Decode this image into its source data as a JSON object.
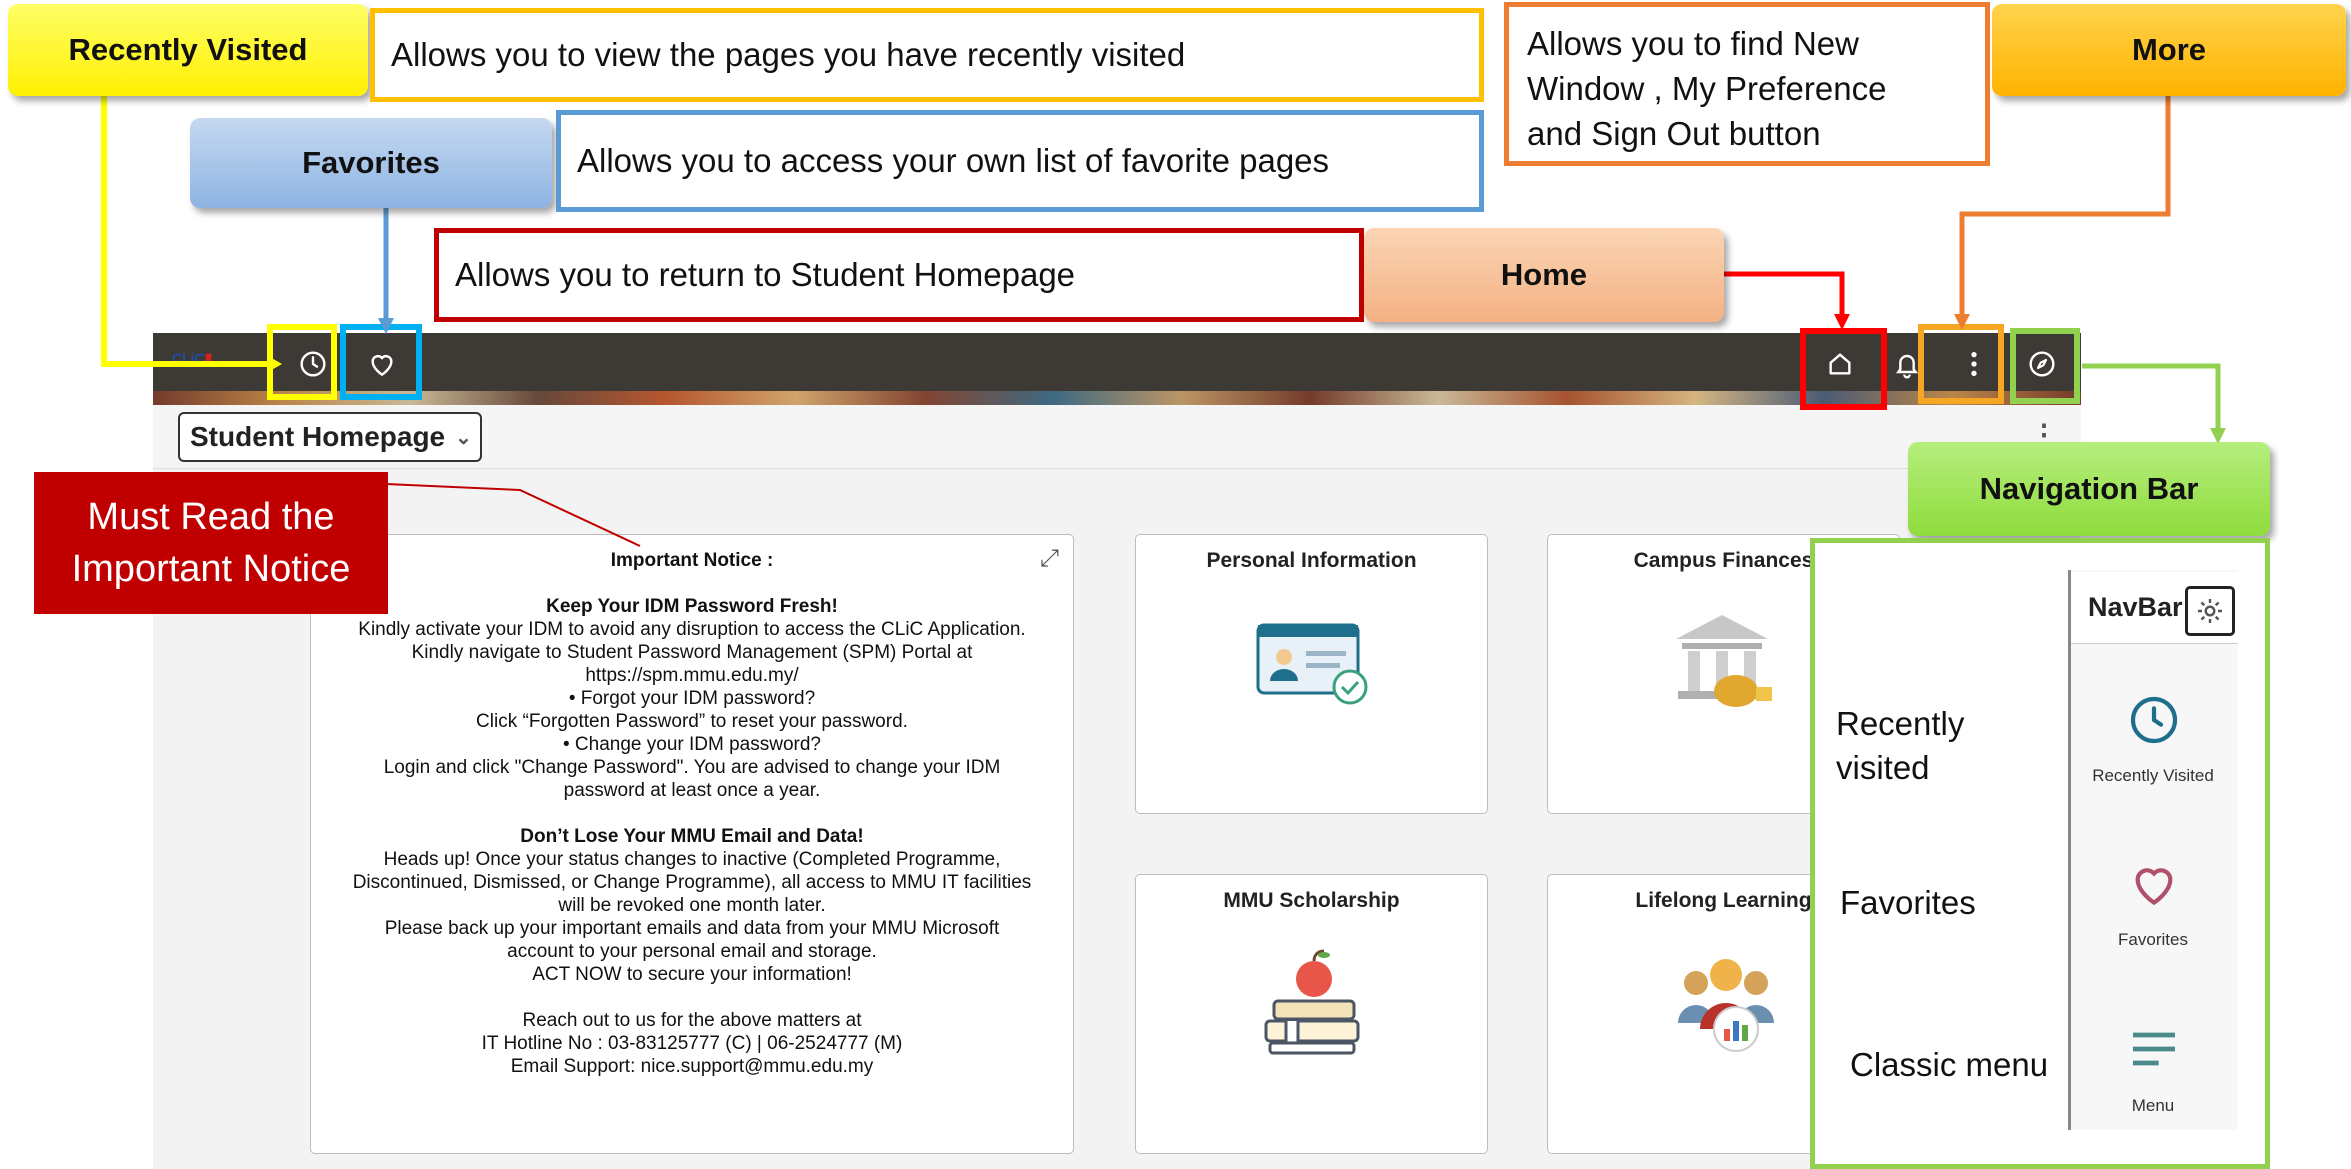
{
  "app": {
    "logo_prefix": "CLiC",
    "logo_suffix": "▮",
    "homepage_label": "Student Homepage",
    "subheader_menu": "⋮"
  },
  "tiles": {
    "notice": {
      "title": "Important Notice :",
      "h1": "Keep Your IDM Password Fresh!",
      "lines1": [
        "Kindly activate your IDM to avoid any disruption to access the CLiC Application.",
        "Kindly navigate to Student Password Management (SPM) Portal at",
        "https://spm.mmu.edu.my/",
        "• Forgot your IDM password?",
        "Click “Forgotten Password” to reset your password.",
        "• Change your IDM password?",
        "Login and click \"Change Password\". You are advised to change your IDM",
        "password at least once a year."
      ],
      "h2": "Don’t Lose Your MMU Email and Data!",
      "lines2": [
        "Heads up! Once your status changes to inactive (Completed Programme,",
        "Discontinued, Dismissed, or Change Programme), all access to MMU IT facilities",
        "will be revoked one month later.",
        "Please back up your important emails and data from your MMU Microsoft",
        "account to your personal email and storage.",
        "ACT NOW to secure your information!"
      ],
      "lines3": [
        "Reach out to us for the above matters at",
        "IT Hotline No : 03-83125777 (C) | 06-2524777 (M)",
        "Email Support: nice.support@mmu.edu.my"
      ]
    },
    "personal_information": "Personal Information",
    "campus_finances": "Campus Finances",
    "mmu_scholarship": "MMU Scholarship",
    "lifelong_learning": "Lifelong Learning"
  },
  "annotations": {
    "recently_visited_tag": "Recently Visited",
    "recently_visited_desc": "Allows you to view the pages you have recently visited",
    "favorites_tag": "Favorites",
    "favorites_desc": "Allows you to access your own list of favorite pages",
    "home_tag": "Home",
    "home_desc": "Allows you to return to Student Homepage",
    "more_tag": "More",
    "more_desc_1": "Allows you to find New",
    "more_desc_2": "Window , My Preference",
    "more_desc_3": "and Sign Out button",
    "notice_tag_1": "Must Read the",
    "notice_tag_2": "Important Notice",
    "navbar_tag": "Navigation Bar"
  },
  "navbar_panel": {
    "title": "NavBar",
    "recently_visited": "Recently Visited",
    "favorites": "Favorites",
    "menu": "Menu",
    "side_recently_1": "Recently",
    "side_recently_2": "visited",
    "side_favorites": "Favorites",
    "side_classic": "Classic menu"
  },
  "colors": {
    "yellow": "#ffff00",
    "blue_box": "#00b0f0",
    "red_box": "#ff0000",
    "orange_box": "#f5a623",
    "green_box": "#92d050",
    "dark_red": "#c00000",
    "callout_orange": "#ed7d31",
    "callout_blue": "#5b9bd5",
    "callout_red": "#c00000",
    "callout_gold": "#ffc000",
    "icon_teal": "#1e6f8c"
  }
}
